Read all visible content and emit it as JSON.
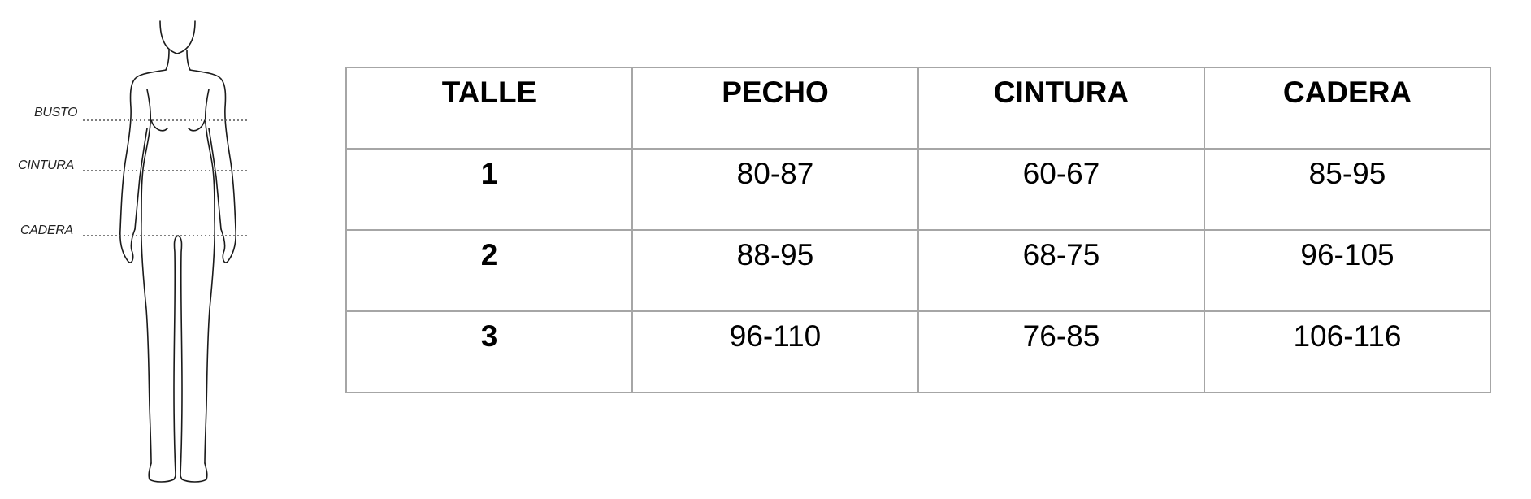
{
  "figure": {
    "icon": "female-body-silhouette-icon",
    "labels": {
      "busto": "BUSTO",
      "cintura": "CINTURA",
      "cadera": "CADERA"
    }
  },
  "size_table": {
    "headers": [
      "TALLE",
      "PECHO",
      "CINTURA",
      "CADERA"
    ],
    "rows": [
      [
        "1",
        "80-87",
        "60-67",
        "85-95"
      ],
      [
        "2",
        "88-95",
        "68-75",
        "96-105"
      ],
      [
        "3",
        "96-110",
        "76-85",
        "106-116"
      ]
    ],
    "border_color": "#a6a6a6"
  }
}
